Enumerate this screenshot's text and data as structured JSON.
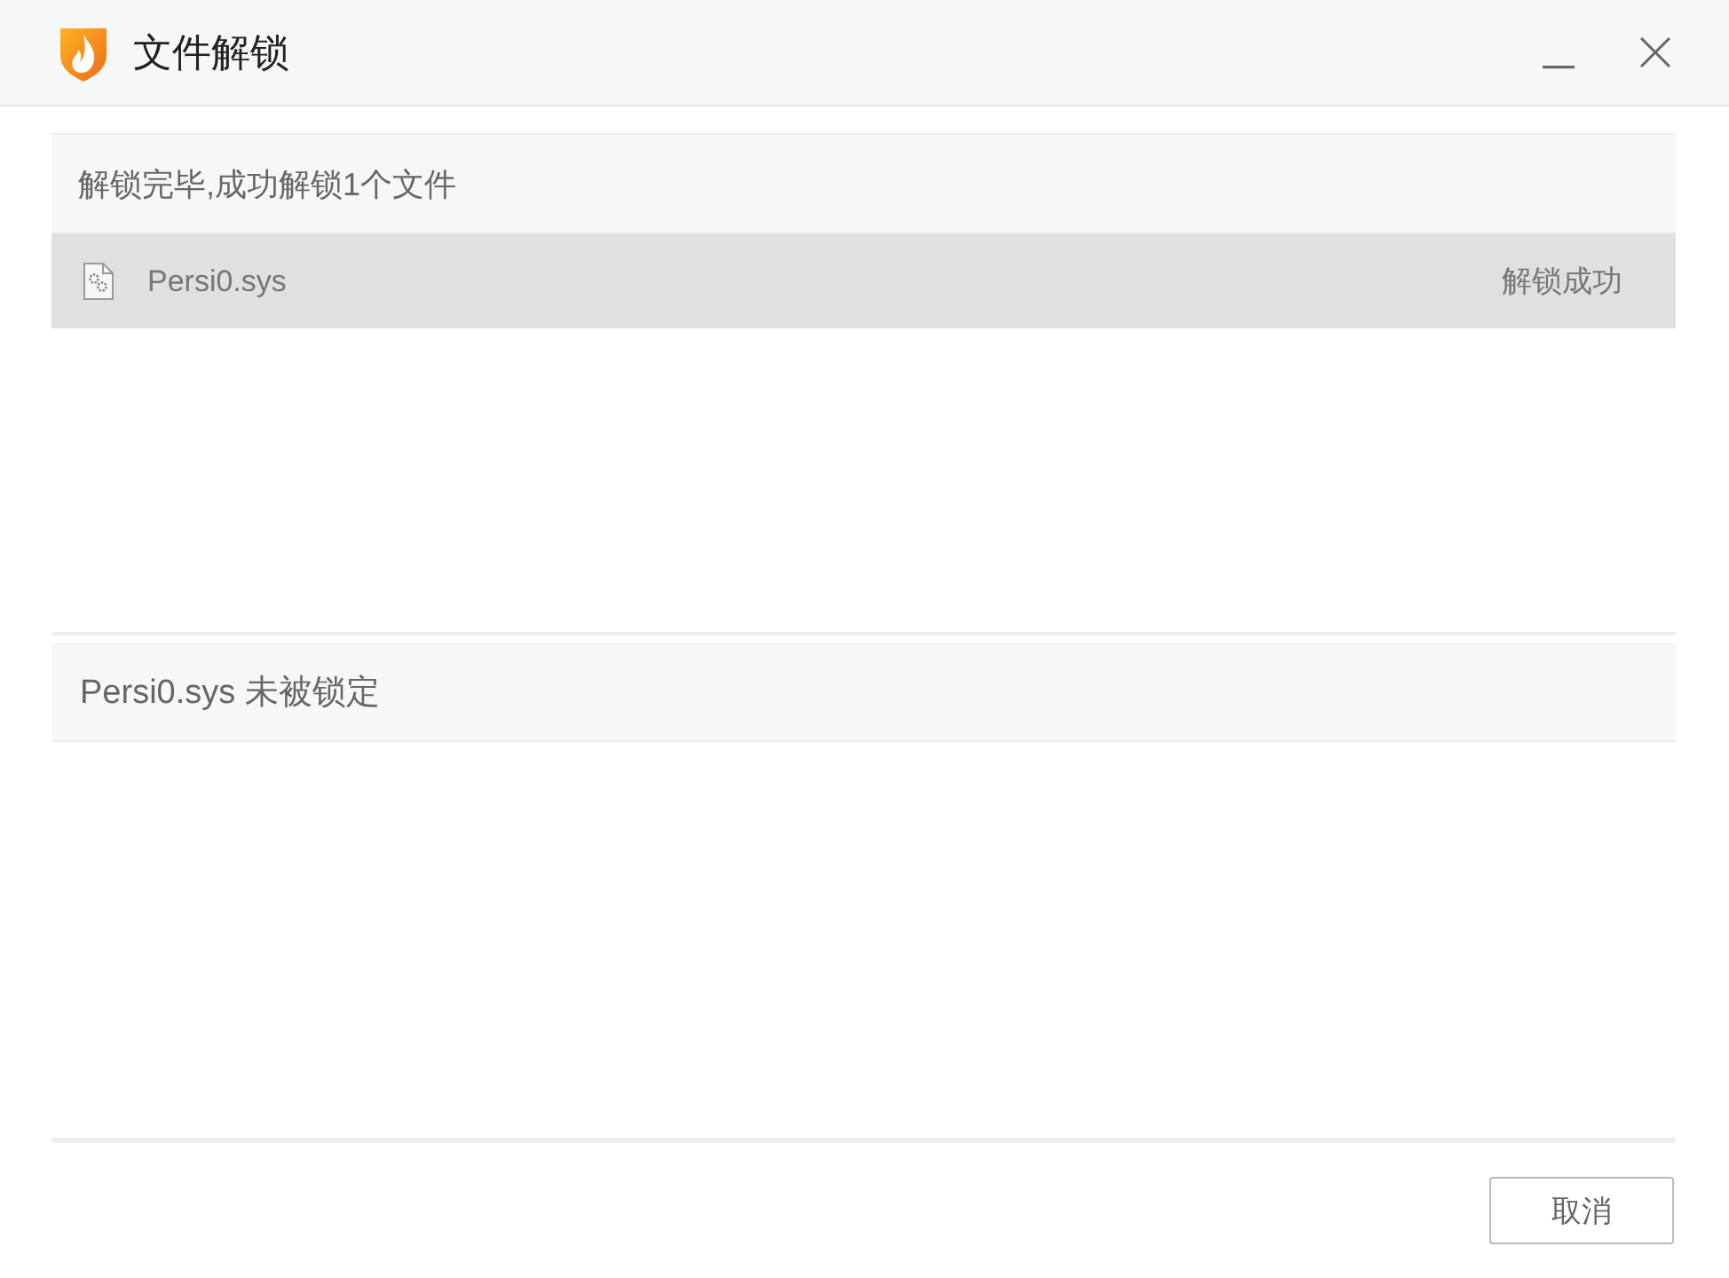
{
  "window": {
    "title": "文件解锁"
  },
  "result_list": {
    "summary": "解锁完毕,成功解锁1个文件",
    "files": [
      {
        "name": "Persi0.sys",
        "status": "解锁成功",
        "selected": true
      }
    ]
  },
  "detail": {
    "message": "Persi0.sys 未被锁定"
  },
  "buttons": [
    {
      "label": "取消"
    }
  ]
}
